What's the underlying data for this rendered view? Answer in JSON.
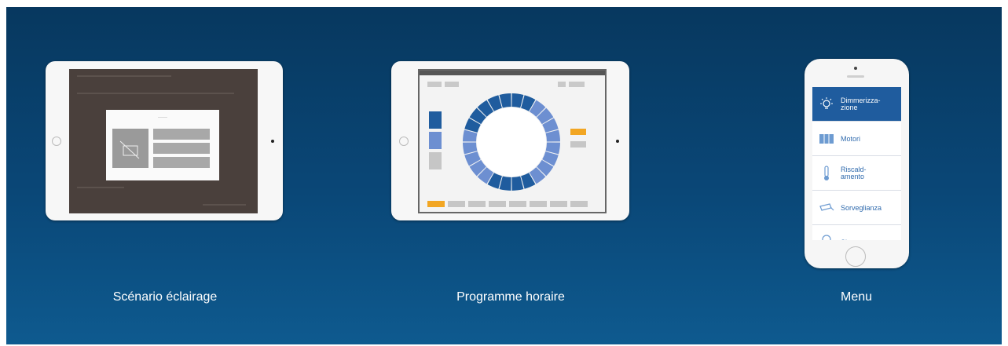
{
  "captions": {
    "left": "Scénario éclairage",
    "center": "Programme horaire",
    "right": "Menu"
  },
  "phone_menu": {
    "items": [
      {
        "label": "Dimmerizza-\nzione",
        "icon": "lightbulb-icon",
        "active": true
      },
      {
        "label": "Motori",
        "icon": "blinds-icon",
        "active": false
      },
      {
        "label": "Riscald-\namento",
        "icon": "thermometer-icon",
        "active": false
      },
      {
        "label": "Sorveglianza",
        "icon": "camera-icon",
        "active": false
      },
      {
        "label": "Sicurezza",
        "icon": "lock-icon",
        "active": false
      }
    ]
  },
  "colors": {
    "background_top": "#07385f",
    "background_bottom": "#0e5a8f",
    "accent_blue": "#1f5c9e",
    "accent_orange": "#f2a623"
  }
}
